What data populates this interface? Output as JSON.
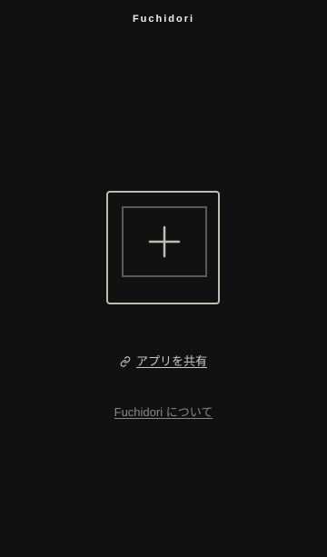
{
  "header": {
    "title": "Fuchidori"
  },
  "main": {
    "add_button_icon": "plus-icon",
    "share": {
      "label": "アプリを共有",
      "icon": "link-icon"
    },
    "about": {
      "label": "Fuchidori について"
    }
  },
  "colors": {
    "background": "#111111",
    "frame_outer": "#bdbdb6",
    "frame_inner": "#5a5a58",
    "text_primary": "#f2f2f2",
    "text_link": "#c9c9c9",
    "text_muted": "#8a8a8a"
  }
}
